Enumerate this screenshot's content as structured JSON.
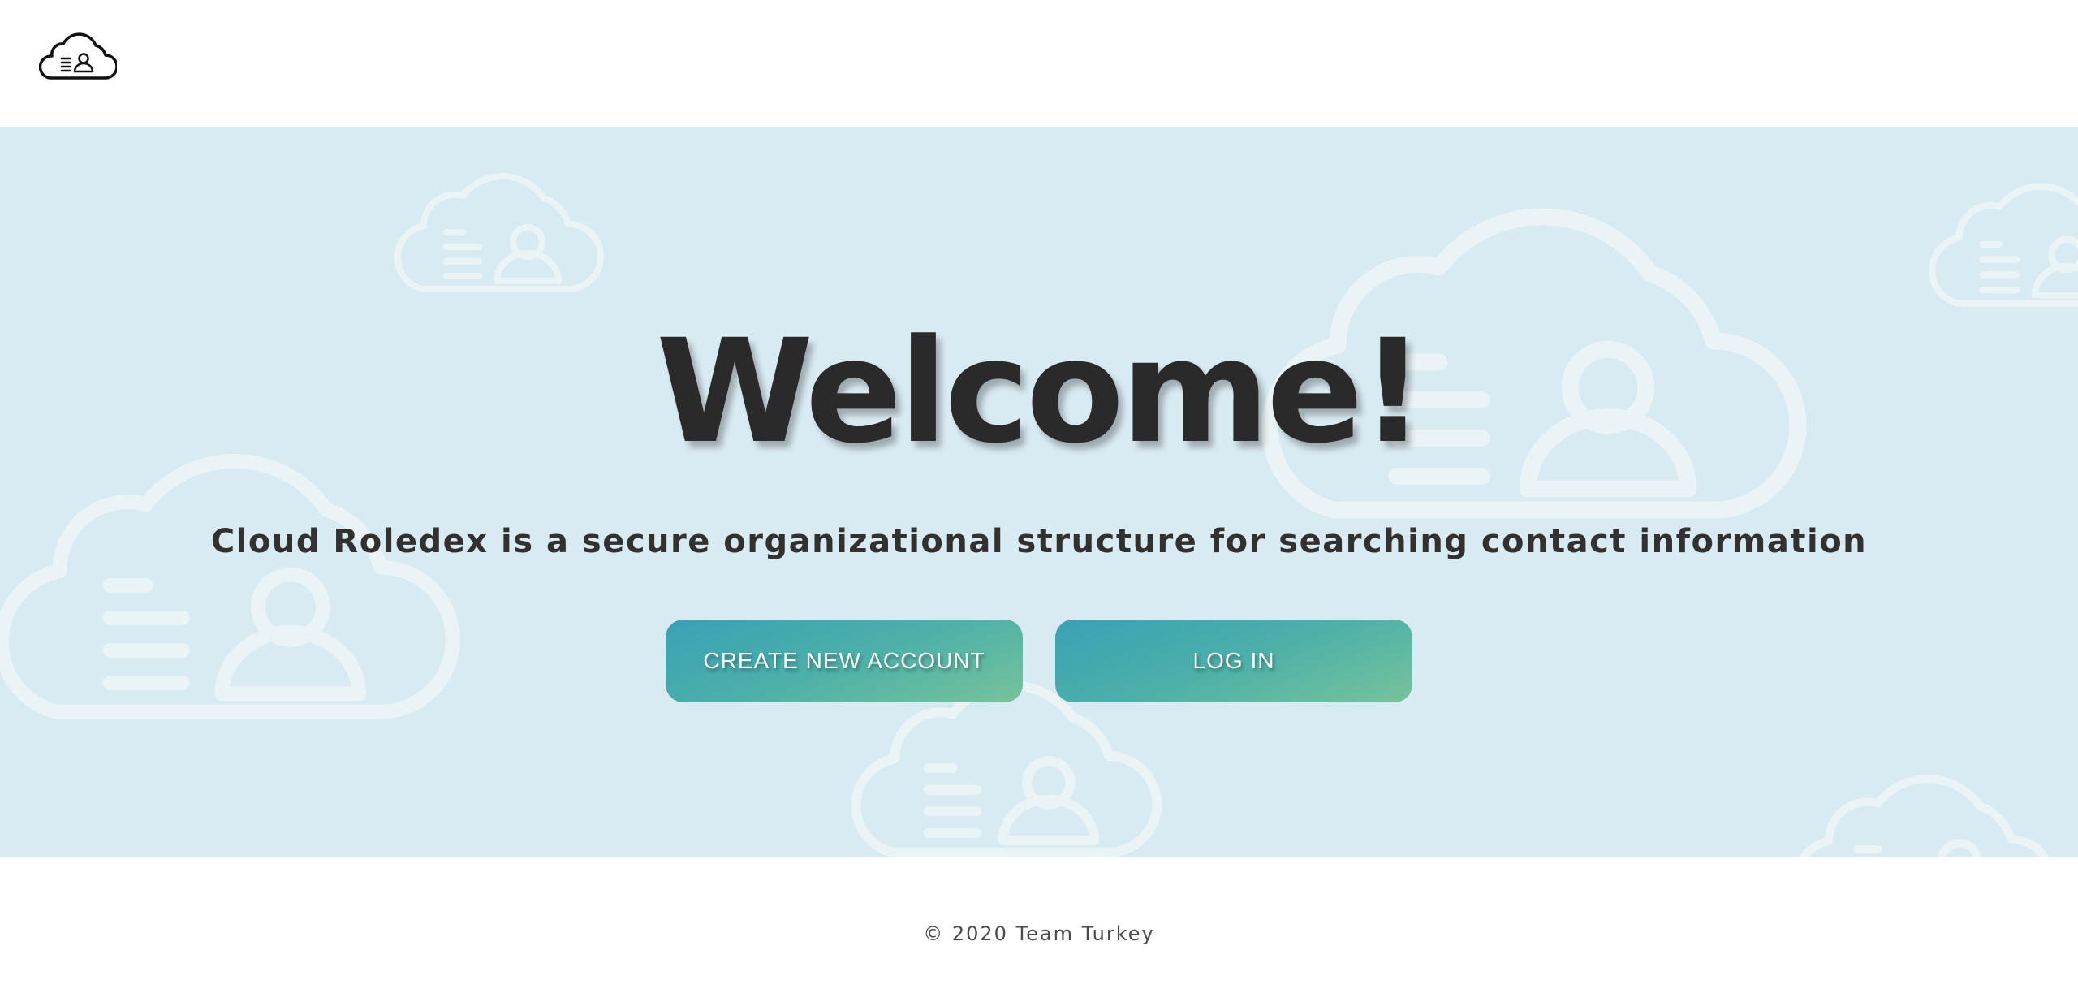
{
  "header": {
    "logo_icon": "cloud-contact-icon"
  },
  "hero": {
    "title": "Welcome!",
    "tagline": "Cloud Roledex is a secure organizational structure for searching contact information",
    "background_icon": "cloud-contact-icon",
    "background_color": "#d9ebf2"
  },
  "actions": {
    "create_account_label": "CREATE NEW ACCOUNT",
    "login_label": "LOG IN",
    "button_gradient_start": "#3aa1b4",
    "button_gradient_end": "#76c39b"
  },
  "footer": {
    "copyright": "© 2020 Team Turkey"
  }
}
